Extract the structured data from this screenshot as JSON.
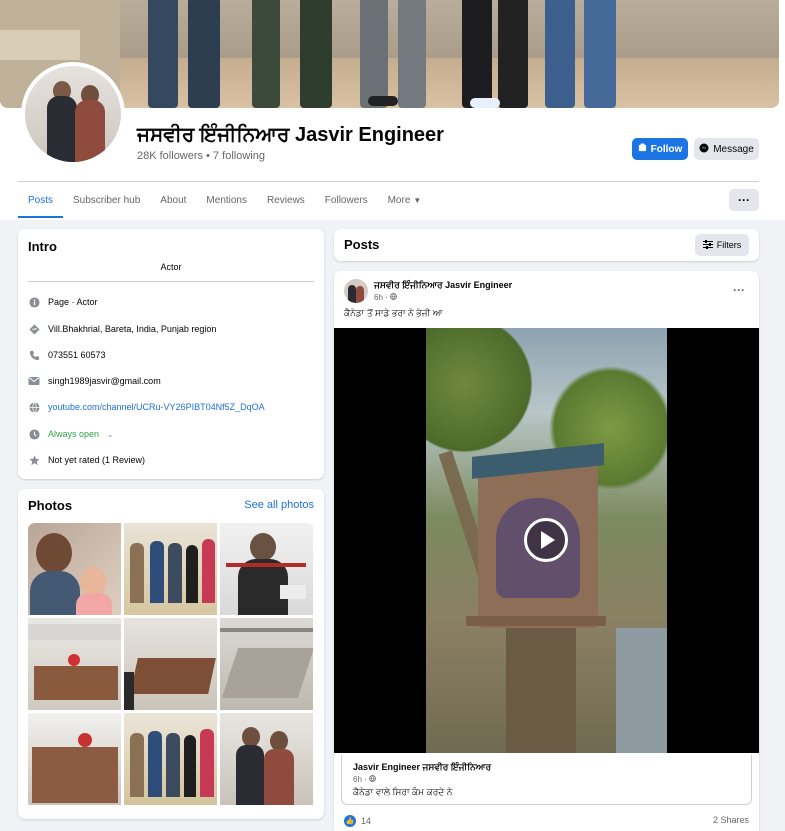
{
  "page": {
    "name": "ਜਸਵੀਰ ਇੰਜੀਨਿਆਰ Jasvir Engineer",
    "stats": "28K followers • 7 following"
  },
  "actions": {
    "follow": "Follow",
    "message": "Message",
    "more_dots": "···"
  },
  "tabs": [
    "Posts",
    "Subscriber hub",
    "About",
    "Mentions",
    "Reviews",
    "Followers",
    "More"
  ],
  "intro": {
    "title": "Intro",
    "category": "Actor",
    "rows": [
      {
        "icon": "info-icon",
        "text": "Page · Actor"
      },
      {
        "icon": "location-icon",
        "text": "Vill.Bhakhrial, Bareta, India, Punjab region"
      },
      {
        "icon": "phone-icon",
        "text": "073551 60573"
      },
      {
        "icon": "email-icon",
        "text": "singh1989jasvir@gmail.com"
      },
      {
        "icon": "globe-icon",
        "text": "youtube.com/channel/UCRu-VY26PIBT04Nf5Z_DqOA"
      },
      {
        "icon": "clock-icon",
        "text": "Always open"
      },
      {
        "icon": "star-icon",
        "text": "Not yet rated (1 Review)"
      }
    ]
  },
  "photos": {
    "title": "Photos",
    "see_all": "See all photos"
  },
  "posts_header": {
    "title": "Posts",
    "filters": "Filters"
  },
  "post": {
    "author": "ਜਸਵੀਰ ਇੰਜੀਨਿਆਰ Jasvir Engineer",
    "time": "6h ·",
    "text": "ਕੈਨੇਡਾ ਤੋਂ ਸਾਡੇ ਭਰਾ ਨੇ ਭੇਜੀ ਆ",
    "shared": {
      "author": "Jasvir Engineer ਜਸਵੀਰ ਇੰਜੀਨਿਆਰ",
      "time": "6h ·",
      "text": "ਕੈਨੇਡਾ ਵਾਲੇ ਸਿਰਾ ਕੰਮ ਕਰਦੇ ਨੇ"
    },
    "reactions": "14",
    "shares": "2 Shares"
  },
  "colors": {
    "accent": "#1b74e4",
    "background": "#f0f2f5",
    "green": "#31a24c"
  }
}
